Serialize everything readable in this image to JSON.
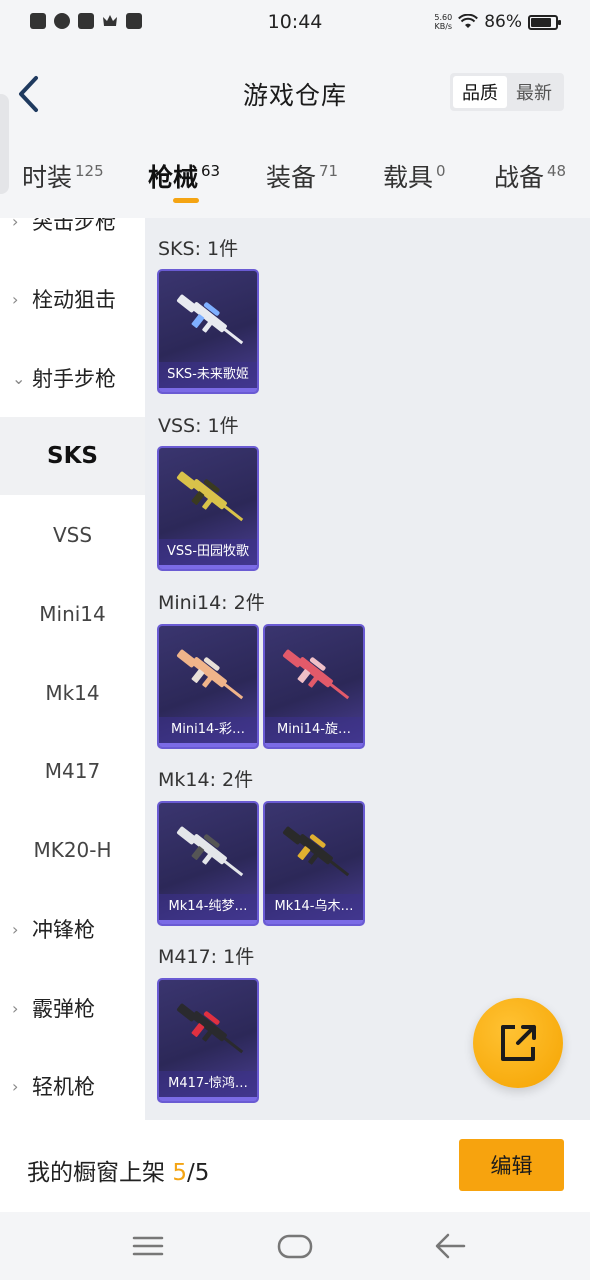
{
  "status_bar": {
    "time": "10:44",
    "net_speed_value": "5.60",
    "net_speed_unit": "KB/s",
    "battery": "86%"
  },
  "header": {
    "title": "游戏仓库",
    "sort_options": [
      "品质",
      "最新"
    ],
    "sort_selected": "品质"
  },
  "tabs": [
    {
      "label": "时装",
      "count": "125"
    },
    {
      "label": "枪械",
      "count": "63"
    },
    {
      "label": "装备",
      "count": "71"
    },
    {
      "label": "载具",
      "count": "0"
    },
    {
      "label": "战备",
      "count": "48"
    }
  ],
  "active_tab": "枪械",
  "sidebar": {
    "groups": [
      {
        "label": "突击步枪",
        "state": "partially-visible"
      },
      {
        "label": "栓动狙击",
        "state": "collapsed"
      },
      {
        "label": "射手步枪",
        "state": "expanded"
      },
      {
        "label": "冲锋枪",
        "state": "collapsed"
      },
      {
        "label": "霰弹枪",
        "state": "collapsed"
      },
      {
        "label": "轻机枪",
        "state": "collapsed"
      }
    ],
    "subitems": [
      "SKS",
      "VSS",
      "Mini14",
      "Mk14",
      "M417",
      "MK20-H"
    ],
    "active_subitem": "SKS"
  },
  "sections": [
    {
      "title": "SKS: 1件",
      "items": [
        {
          "name": "SKS-未来歌姬",
          "gun_color": "#e8eaf0",
          "accent": "#7fb0ff"
        }
      ]
    },
    {
      "title": "VSS: 1件",
      "items": [
        {
          "name": "VSS-田园牧歌",
          "gun_color": "#d9c24a",
          "accent": "#3a3a20"
        }
      ]
    },
    {
      "title": "Mini14: 2件",
      "items": [
        {
          "name": "Mini14-彩…",
          "gun_color": "#f0b48a",
          "accent": "#e8e0d8"
        },
        {
          "name": "Mini14-旋…",
          "gun_color": "#e25a6a",
          "accent": "#f0c0c8"
        }
      ]
    },
    {
      "title": "Mk14: 2件",
      "items": [
        {
          "name": "Mk14-纯梦…",
          "gun_color": "#e4e6ea",
          "accent": "#555"
        },
        {
          "name": "Mk14-乌木…",
          "gun_color": "#2a2a2a",
          "accent": "#e0b030"
        }
      ]
    },
    {
      "title": "M417: 1件",
      "items": [
        {
          "name": "M417-惊鸿…",
          "gun_color": "#2a2a2e",
          "accent": "#e03040"
        }
      ]
    }
  ],
  "bottom_bar": {
    "showcase_label": "我的橱窗上架",
    "showcase_current": "5",
    "showcase_total": "/5",
    "edit_label": "编辑"
  },
  "colors": {
    "accent": "#f4a413",
    "card_border": "#6a5bd3",
    "fab": "#f5a300"
  },
  "icons": {
    "back": "back-arrow-icon",
    "fab": "share-external-icon",
    "nav": [
      "menu-icon",
      "home-icon",
      "back-icon"
    ]
  }
}
